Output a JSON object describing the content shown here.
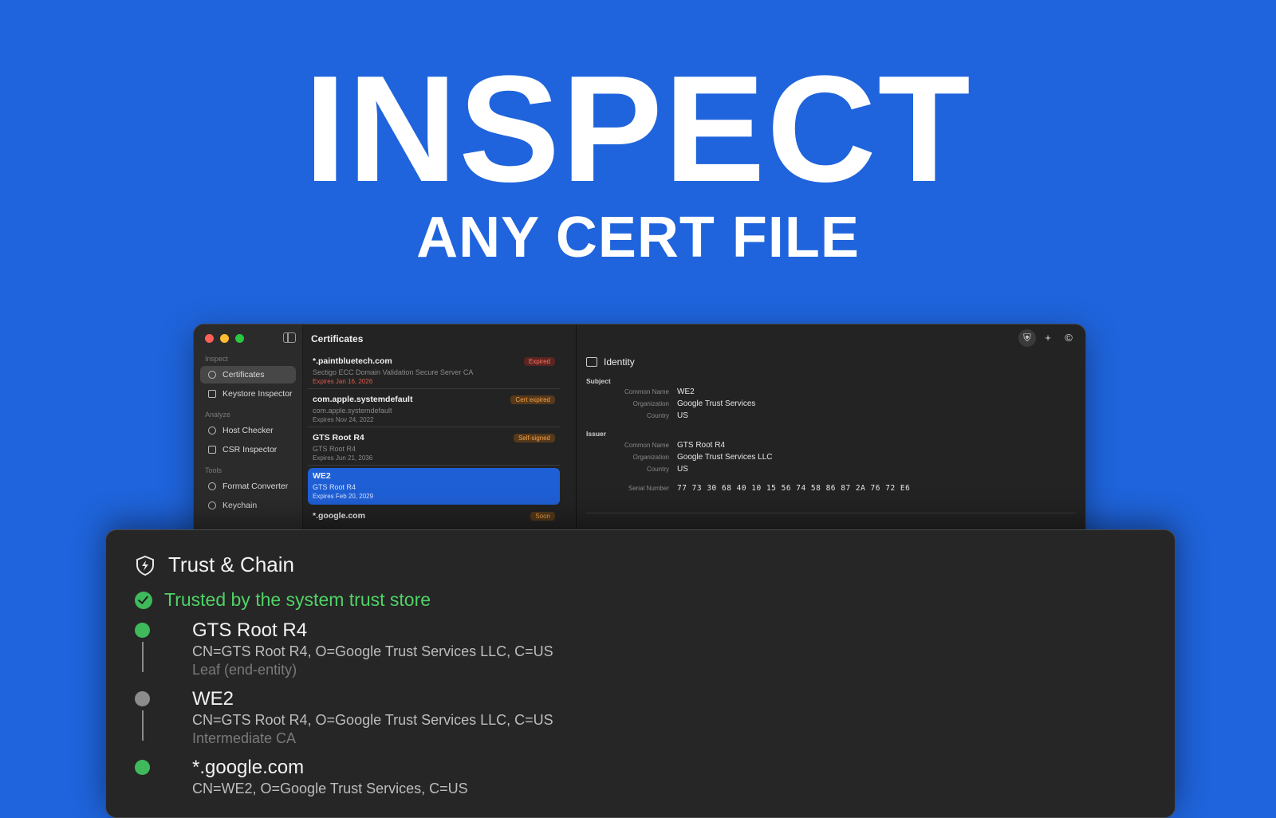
{
  "headline": {
    "title": "INSPECT",
    "subtitle": "ANY CERT FILE"
  },
  "window": {
    "traffic_lights": [
      "#ff5f57",
      "#febc2e",
      "#28c840"
    ],
    "sidebar": {
      "sections": [
        {
          "label": "Inspect",
          "items": [
            {
              "label": "Certificates",
              "icon": "certificate-icon",
              "active": true
            },
            {
              "label": "Keystore Inspector",
              "icon": "keystore-icon"
            }
          ]
        },
        {
          "label": "Analyze",
          "items": [
            {
              "label": "Host Checker",
              "icon": "host-icon"
            },
            {
              "label": "CSR Inspector",
              "icon": "csr-icon"
            }
          ]
        },
        {
          "label": "Tools",
          "items": [
            {
              "label": "Format Converter",
              "icon": "convert-icon"
            },
            {
              "label": "Keychain",
              "icon": "key-icon"
            }
          ]
        }
      ]
    },
    "list": {
      "title": "Certificates",
      "rows": [
        {
          "name": "*.paintbluetech.com",
          "subtitle": "Sectigo ECC Domain Validation Secure Server CA",
          "expiry": "Expires Jan 16, 2026",
          "badge": "Expired",
          "badge_color": "red"
        },
        {
          "name": "com.apple.systemdefault",
          "subtitle": "com.apple.systemdefault",
          "expiry": "Expires Nov 24, 2022",
          "badge": "Cert expired",
          "badge_color": "orange"
        },
        {
          "name": "GTS Root R4",
          "subtitle": "GTS Root R4",
          "expiry": "Expires Jun 21, 2036",
          "badge": "Self-signed",
          "badge_color": "orange"
        },
        {
          "name": "WE2",
          "subtitle": "GTS Root R4",
          "expiry": "Expires Feb 20, 2029",
          "badge": "",
          "selected": true
        },
        {
          "name": "*.google.com",
          "subtitle": "",
          "expiry": "",
          "badge": "Soon",
          "badge_color": "orange"
        }
      ]
    },
    "detail": {
      "toolbar": {
        "shield": "shield-icon",
        "add": "+",
        "info": "©"
      },
      "identity_heading": "Identity",
      "subject": {
        "label": "Subject",
        "common_name_key": "Common Name",
        "common_name": "WE2",
        "org_key": "Organization",
        "org": "Google Trust Services",
        "country_key": "Country",
        "country": "US"
      },
      "issuer": {
        "label": "Issuer",
        "common_name_key": "Common Name",
        "common_name": "GTS Root R4",
        "org_key": "Organization",
        "org": "Google Trust Services LLC",
        "country_key": "Country",
        "country": "US"
      },
      "serial_key": "Serial Number",
      "serial": "77 73 30 68 40 10 15 56 74 58 86 87 2A 76 72 E6"
    }
  },
  "trust_panel": {
    "title": "Trust & Chain",
    "status": "Trusted by the system trust store",
    "chain": [
      {
        "name": "GTS Root R4",
        "dn": "CN=GTS Root R4, O=Google Trust Services LLC, C=US",
        "role": "Leaf (end-entity)",
        "color": "#3fb95b"
      },
      {
        "name": "WE2",
        "dn": "CN=GTS Root R4, O=Google Trust Services LLC, C=US",
        "role": "Intermediate CA",
        "color": "#8c8c8c"
      },
      {
        "name": "*.google.com",
        "dn": "CN=WE2, O=Google Trust Services, C=US",
        "role": "",
        "color": "#3fb95b"
      }
    ]
  }
}
